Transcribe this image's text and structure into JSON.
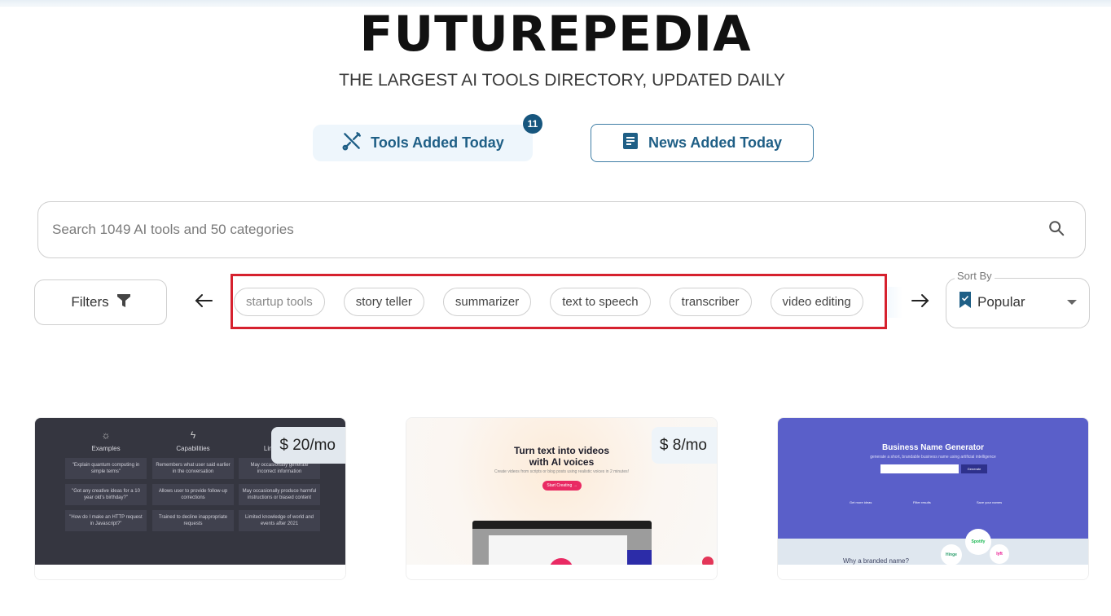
{
  "header": {
    "brand": "FUTUREPEDIA",
    "tagline": "THE LARGEST AI TOOLS DIRECTORY, UPDATED DAILY"
  },
  "tabs": {
    "tools": {
      "label": "Tools Added Today",
      "badge": "11",
      "icon": "tools-icon"
    },
    "news": {
      "label": "News Added Today",
      "icon": "document-icon"
    }
  },
  "search": {
    "placeholder": "Search 1049 AI tools and 50 categories",
    "value": "",
    "icon": "search-icon"
  },
  "filters": {
    "label": "Filters",
    "icon": "funnel-icon"
  },
  "categories": {
    "prev_icon": "arrow-left-icon",
    "next_icon": "arrow-right-icon",
    "items": [
      {
        "label": "startup tools"
      },
      {
        "label": "story teller"
      },
      {
        "label": "summarizer"
      },
      {
        "label": "text to speech"
      },
      {
        "label": "transcriber"
      },
      {
        "label": "video editing"
      }
    ]
  },
  "sort": {
    "label": "Sort By",
    "value": "Popular",
    "icon": "bookmark-check-icon"
  },
  "cards": [
    {
      "price": "$ 20/mo",
      "preview": {
        "columns": [
          {
            "icon": "sun-icon",
            "title": "Examples",
            "items": [
              "\"Explain quantum computing in simple terms\"",
              "\"Got any creative ideas for a 10 year old's birthday?\"",
              "\"How do I make an HTTP request in Javascript?\""
            ]
          },
          {
            "icon": "lightning-icon",
            "title": "Capabilities",
            "items": [
              "Remembers what user said earlier in the conversation",
              "Allows user to provide follow-up corrections",
              "Trained to decline inappropriate requests"
            ]
          },
          {
            "icon": "warning-icon",
            "title": "Limitations",
            "items": [
              "May occasionally generate incorrect information",
              "May occasionally produce harmful instructions or biased content",
              "Limited knowledge of world and events after 2021"
            ]
          }
        ]
      }
    },
    {
      "price": "$ 8/mo",
      "preview": {
        "headline_1": "Turn text into videos",
        "headline_2": "with AI voices",
        "subtext": "Create videos from scripts or blog posts using realistic voices in 2 minutes!",
        "cta": "Start Creating →"
      }
    },
    {
      "price": "",
      "preview": {
        "headline": "Business Name Generator",
        "subtext": "generate a short, brandable business name using artificial intelligence",
        "button": "Generate",
        "features": [
          "Get more ideas",
          "Filter results",
          "Save your names"
        ],
        "section": "Why a branded name?",
        "logos": [
          "Spotify",
          "Hinge",
          "lyft"
        ]
      }
    }
  ],
  "colors": {
    "accent": "#1f5f86",
    "badge": "#17567e",
    "highlight": "#d6212e"
  }
}
